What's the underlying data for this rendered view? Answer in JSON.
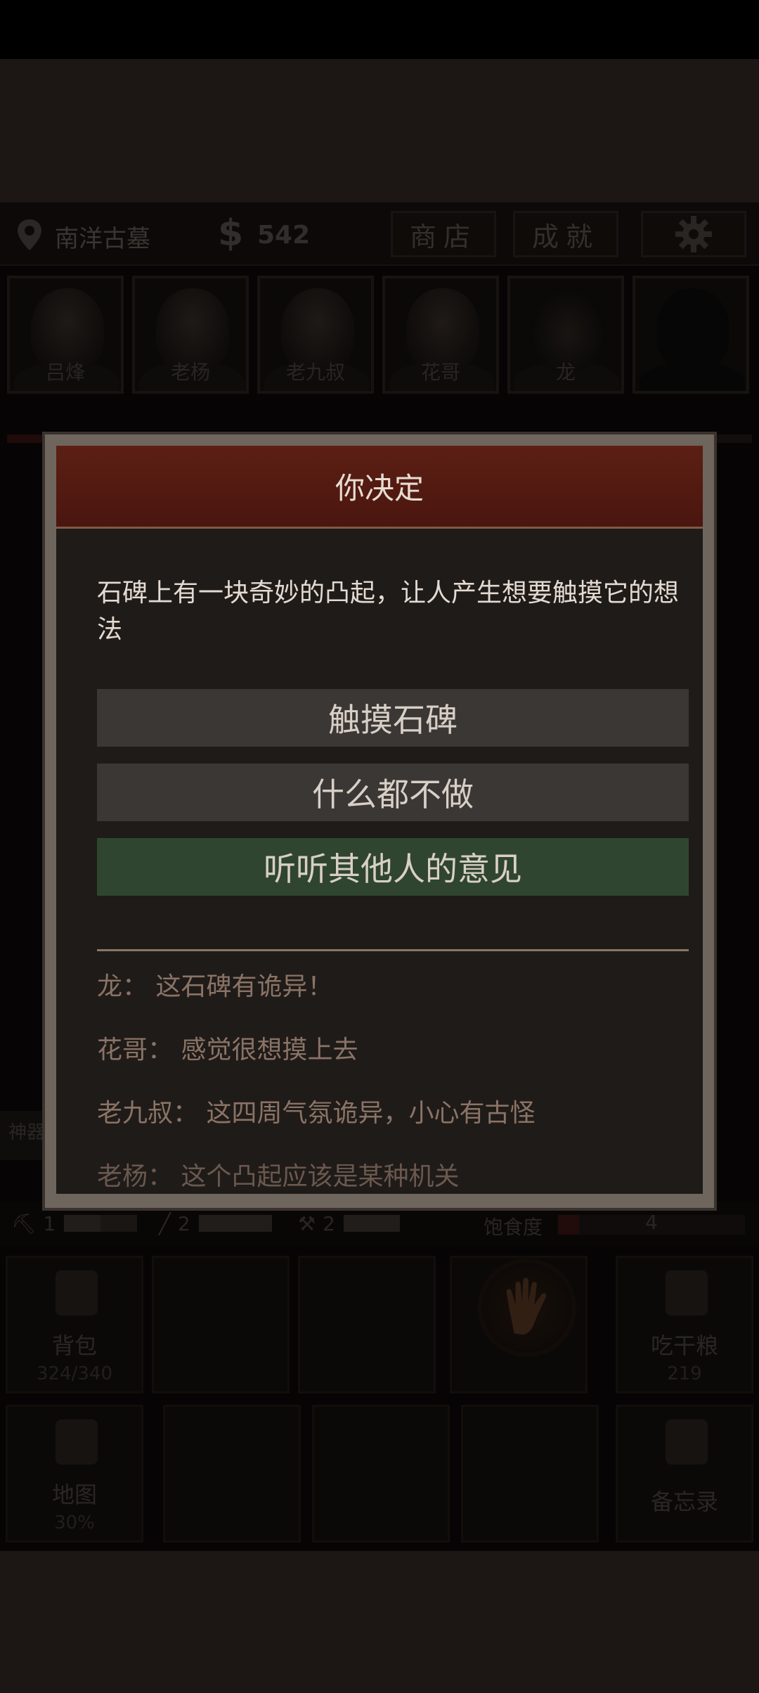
{
  "hud": {
    "location": "南洋古墓",
    "money": "542",
    "shop_label": "商店",
    "achievements_label": "成就"
  },
  "team": [
    {
      "name": "吕烽"
    },
    {
      "name": "老杨"
    },
    {
      "name": "老九叔"
    },
    {
      "name": "花哥"
    },
    {
      "name": "龙"
    },
    {
      "name": ""
    }
  ],
  "artifact_tag": "神器",
  "tools": [
    {
      "count": "1",
      "fill": 0.5
    },
    {
      "count": "2",
      "fill": 1.0
    },
    {
      "count": "2",
      "fill": 1.0
    }
  ],
  "hunger": {
    "label": "饱食度",
    "value": "4"
  },
  "grid": {
    "backpack": {
      "label": "背包",
      "sub": "324/340"
    },
    "eat": {
      "label": "吃干粮",
      "sub": "219"
    },
    "map": {
      "label": "地图",
      "sub": "30%"
    },
    "memo": {
      "label": "备忘录"
    }
  },
  "dialog": {
    "title": "你决定",
    "message": "石碑上有一块奇妙的凸起，让人产生想要触摸它的想法",
    "choices": [
      "触摸石碑",
      "什么都不做",
      "听听其他人的意见"
    ],
    "chat": [
      "龙：  这石碑有诡异！",
      "花哥：  感觉很想摸上去",
      "老九叔：  这四周气氛诡异，小心有古怪",
      "老杨：  这个凸起应该是某种机关"
    ]
  }
}
